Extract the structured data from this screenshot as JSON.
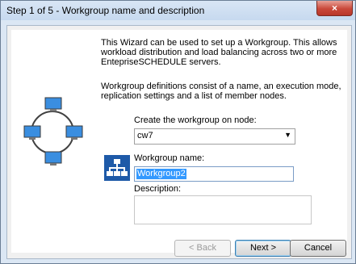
{
  "window": {
    "title": "Step 1 of 5 - Workgroup name and description",
    "close_glyph": "×"
  },
  "intro": {
    "paragraph1": "This Wizard can be used to set up a Workgroup. This allows workload distribution and load balancing across two or more EntepriseSCHEDULE servers.",
    "paragraph2": "Workgroup definitions consist  of a name, an execution mode, replication settings and a list of member nodes."
  },
  "form": {
    "node_label": "Create the workgroup on node:",
    "node_value": "cw7",
    "name_label": "Workgroup name:",
    "name_value": "Workgroup2",
    "description_label": "Description:",
    "description_value": ""
  },
  "buttons": {
    "back": "< Back",
    "next": "Next >",
    "cancel": "Cancel"
  }
}
